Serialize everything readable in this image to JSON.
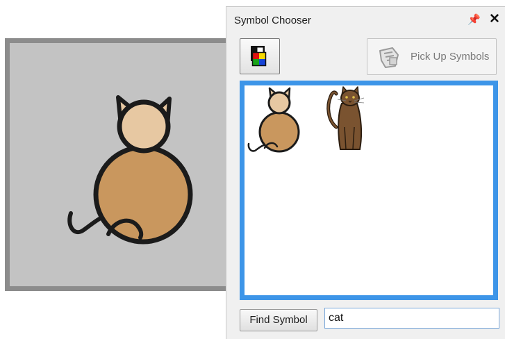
{
  "panel": {
    "title": "Symbol Chooser",
    "pin_icon": "pin-icon",
    "close_icon": "close-icon"
  },
  "toolbar": {
    "color_picker_icon": "color-picker-icon",
    "pickup_label": "Pick Up Symbols",
    "pickup_icon": "hand-pickup-icon"
  },
  "results": [
    {
      "name": "cartoon-cat-symbol"
    },
    {
      "name": "brown-cat-symbol"
    }
  ],
  "search": {
    "button_label": "Find Symbol",
    "value": "cat"
  },
  "colors": {
    "results_border": "#3d95e8",
    "preview_background": "#c3c3c3",
    "cat_body": "#c9975e",
    "cat_head": "#e7c8a2"
  }
}
